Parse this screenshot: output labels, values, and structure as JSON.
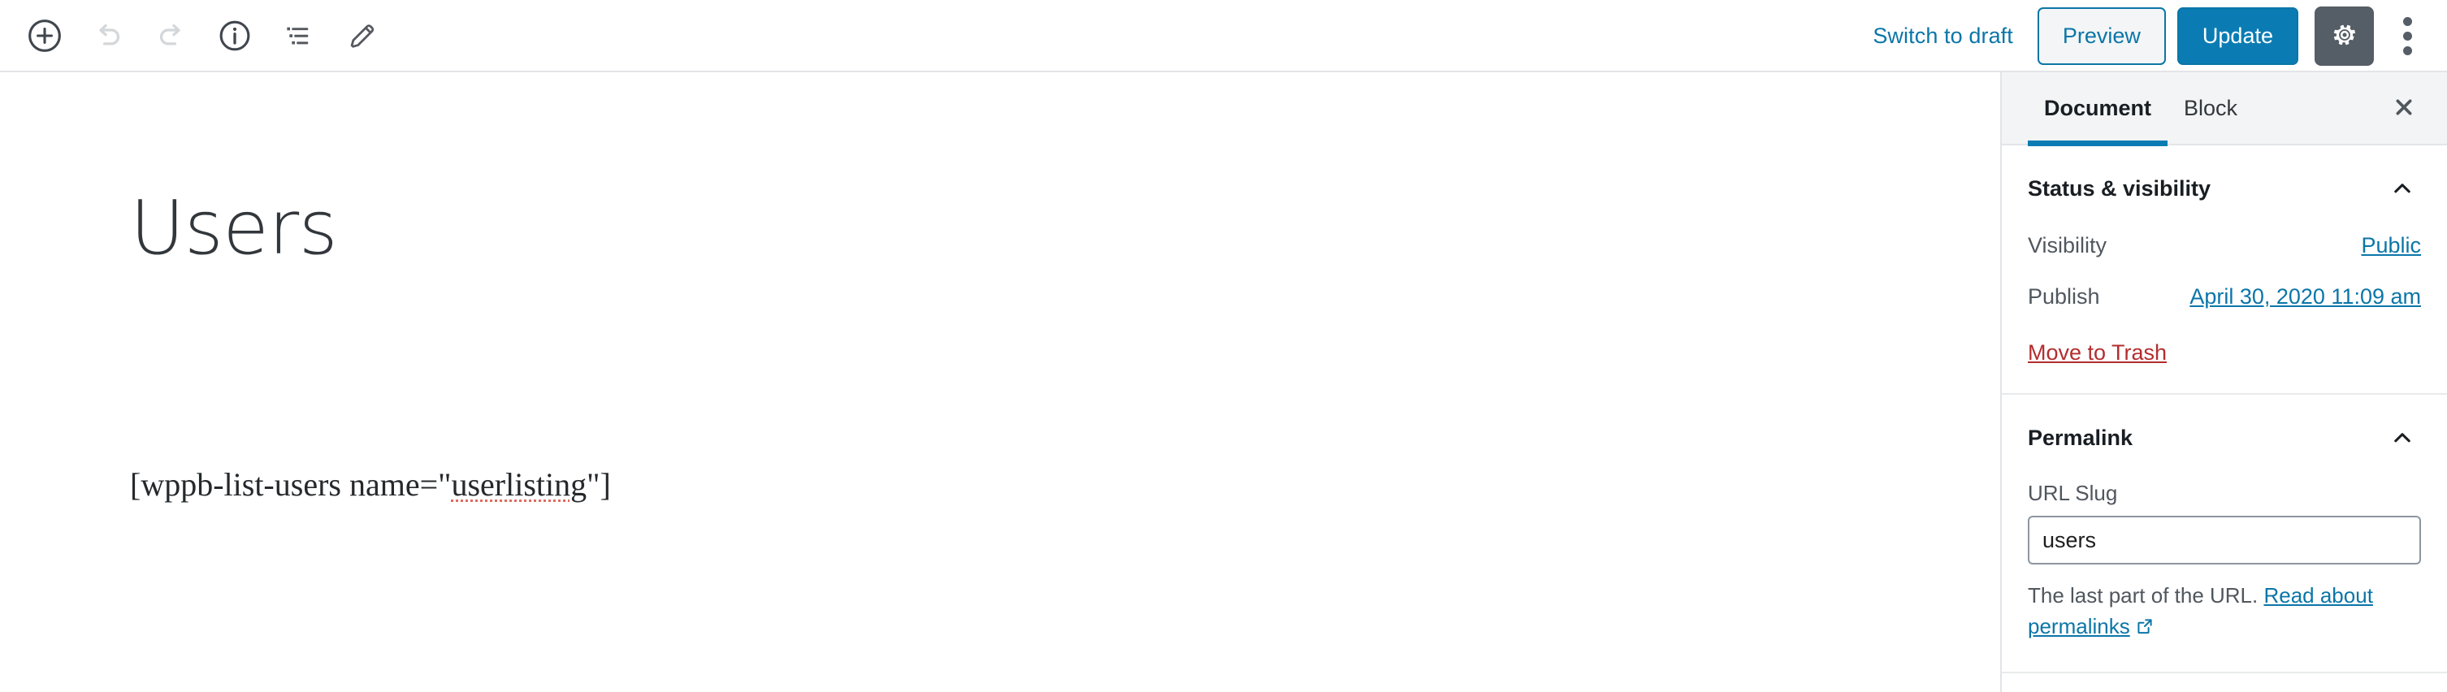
{
  "toolbar": {
    "icons": [
      {
        "name": "add-block-icon",
        "label": "Add block"
      },
      {
        "name": "undo-icon",
        "label": "Undo"
      },
      {
        "name": "redo-icon",
        "label": "Redo"
      },
      {
        "name": "info-icon",
        "label": "Content structure"
      },
      {
        "name": "list-view-icon",
        "label": "Block navigation"
      },
      {
        "name": "pencil-icon",
        "label": "Edit"
      }
    ],
    "switch_to_draft_label": "Switch to draft",
    "preview_label": "Preview",
    "update_label": "Update",
    "settings_icon": "gear-icon",
    "more_icon": "more-vertical-icon",
    "accent_color": "#0b7cb3",
    "settings_button_color": "#555d66"
  },
  "editor": {
    "title": "Users",
    "body_before": "[wppb-list-users name=\"",
    "body_misspelled": "userlisting",
    "body_after": "\"]"
  },
  "sidebar": {
    "tabs": [
      {
        "label": "Document",
        "active": true
      },
      {
        "label": "Block",
        "active": false
      }
    ],
    "close_icon": "close-icon",
    "panels": [
      {
        "title": "Status & visibility",
        "toggle_icon": "chevron-up-icon",
        "rows": [
          {
            "label": "Visibility",
            "value": "Public"
          },
          {
            "label": "Publish",
            "value": "April 30, 2020 11:09 am"
          }
        ],
        "trash_label": "Move to Trash"
      },
      {
        "title": "Permalink",
        "toggle_icon": "chevron-up-icon",
        "field_label": "URL Slug",
        "field_value": "users",
        "field_placeholder": "users",
        "help_prefix": "The last part of the URL. ",
        "help_link": "Read about permalinks",
        "external_icon": "external-link-icon"
      }
    ]
  }
}
